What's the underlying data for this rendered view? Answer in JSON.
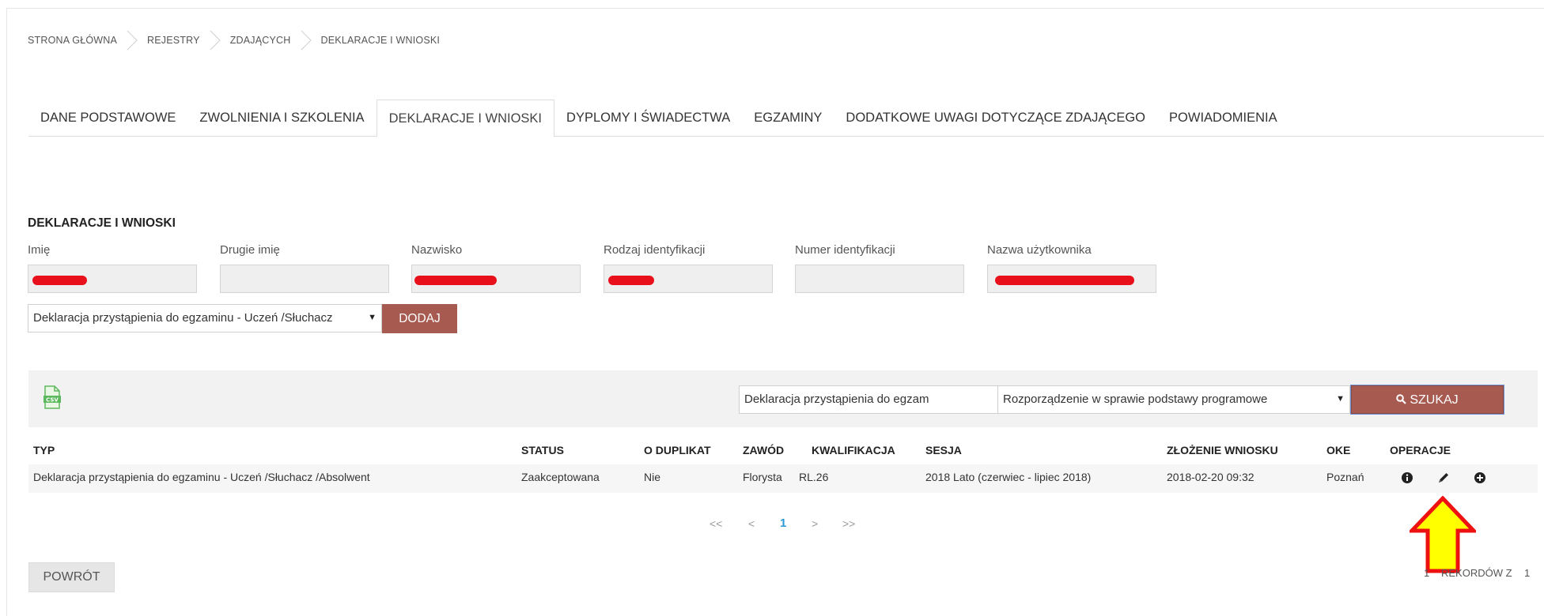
{
  "breadcrumb": [
    "STRONA GŁÓWNA",
    "REJESTRY",
    "ZDAJĄCYCH",
    "DEKLARACJE I WNIOSKI"
  ],
  "tabs": [
    {
      "label": "DANE PODSTAWOWE",
      "active": false
    },
    {
      "label": "ZWOLNIENIA I SZKOLENIA",
      "active": false
    },
    {
      "label": "DEKLARACJE I WNIOSKI",
      "active": true
    },
    {
      "label": "DYPLOMY I ŚWIADECTWA",
      "active": false
    },
    {
      "label": "EGZAMINY",
      "active": false
    },
    {
      "label": "DODATKOWE UWAGI DOTYCZĄCE ZDAJĄCEGO",
      "active": false
    },
    {
      "label": "POWIADOMIENIA",
      "active": false
    }
  ],
  "section_title": "DEKLARACJE I WNIOSKI",
  "fields": {
    "imie": {
      "label": "Imię",
      "redacted": true
    },
    "drugie_imie": {
      "label": "Drugie imię",
      "redacted": false
    },
    "nazwisko": {
      "label": "Nazwisko",
      "redacted": true
    },
    "rodzaj_identyfikacji": {
      "label": "Rodzaj identyfikacji",
      "redacted": true
    },
    "numer_identyfikacji": {
      "label": "Numer identyfikacji",
      "redacted": false
    },
    "nazwa_uzytkownika": {
      "label": "Nazwa użytkownika",
      "redacted": true
    }
  },
  "add_select": {
    "value": "Deklaracja przystąpienia do egzaminu - Uczeń /Słuchacz"
  },
  "add_button": "DODAJ",
  "filter": {
    "type_select": "Deklaracja przystąpienia do egzam",
    "regulation_select": "Rozporządzenie w sprawie podstawy programowe",
    "search_button": "SZUKAJ"
  },
  "table": {
    "headers": {
      "typ": "TYP",
      "status": "STATUS",
      "duplikat": "O DUPLIKAT",
      "zawod": "ZAWÓD",
      "kwalifikacja": "KWALIFIKACJA",
      "sesja": "SESJA",
      "zlozenie": "ZŁOŻENIE WNIOSKU",
      "oke": "OKE",
      "operacje": "OPERACJE"
    },
    "rows": [
      {
        "typ": "Deklaracja przystąpienia do egzaminu - Uczeń /Słuchacz /Absolwent",
        "status": "Zaakceptowana",
        "duplikat": "Nie",
        "zawod": "Florysta",
        "kwalifikacja": "RL.26",
        "sesja": "2018 Lato (czerwiec - lipiec 2018)",
        "zlozenie": "2018-02-20 09:32",
        "oke": "Poznań"
      }
    ]
  },
  "pager": {
    "first": "<<",
    "prev": "<",
    "current": "1",
    "next": ">",
    "last": ">>"
  },
  "back_button": "POWRÓT",
  "records": {
    "shown": "1",
    "label": "REKORDÓW Z",
    "total": "1"
  },
  "colors": {
    "accent_button": "#a75a50",
    "redaction": "#e8101a",
    "pager_current": "#2b9ad6",
    "annotation_arrow": "#ffff00"
  }
}
